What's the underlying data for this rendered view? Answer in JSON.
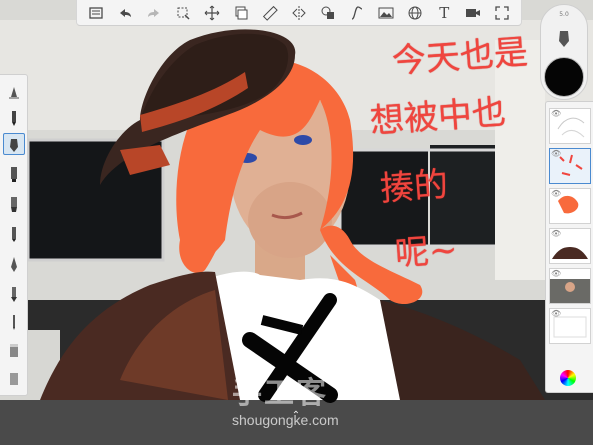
{
  "app": {
    "name": "Sketchbook drawing app"
  },
  "top_toolbar": {
    "items": [
      {
        "name": "gallery",
        "icon": "gallery-icon",
        "enabled": true
      },
      {
        "name": "undo",
        "icon": "undo-icon",
        "enabled": true
      },
      {
        "name": "redo",
        "icon": "redo-icon",
        "enabled": false
      },
      {
        "name": "select",
        "icon": "select-icon",
        "enabled": true
      },
      {
        "name": "transform",
        "icon": "transform-icon",
        "enabled": true
      },
      {
        "name": "layer-copy",
        "icon": "layer-copy-icon",
        "enabled": true
      },
      {
        "name": "ruler",
        "icon": "ruler-icon",
        "enabled": true
      },
      {
        "name": "symmetry",
        "icon": "symmetry-icon",
        "enabled": true
      },
      {
        "name": "fill",
        "icon": "fill-icon",
        "enabled": true
      },
      {
        "name": "curve",
        "icon": "curve-icon",
        "enabled": true
      },
      {
        "name": "image",
        "icon": "image-icon",
        "enabled": true
      },
      {
        "name": "perspective",
        "icon": "perspective-icon",
        "enabled": true
      },
      {
        "name": "text",
        "icon": "text-icon",
        "label": "T",
        "enabled": true
      },
      {
        "name": "camera",
        "icon": "camera-icon",
        "enabled": true
      },
      {
        "name": "fullscreen",
        "icon": "fullscreen-icon",
        "enabled": true
      }
    ]
  },
  "color_puck": {
    "brush_size_label": "5.0",
    "current_color": "#050505"
  },
  "canvas": {
    "handwriting_lines": [
      "今天也是",
      "想被中也",
      "揍的",
      "呢~"
    ],
    "handwriting_color": "#f0453e",
    "hair_color": "#f86a3c",
    "hat_color": "#3a2620",
    "hat_band_color": "#b84628",
    "coat_color": "#4a2a22"
  },
  "watermark": {
    "text": "手工客",
    "url": "shougongke.com"
  },
  "layers": {
    "count": 6,
    "active_index": 1
  }
}
